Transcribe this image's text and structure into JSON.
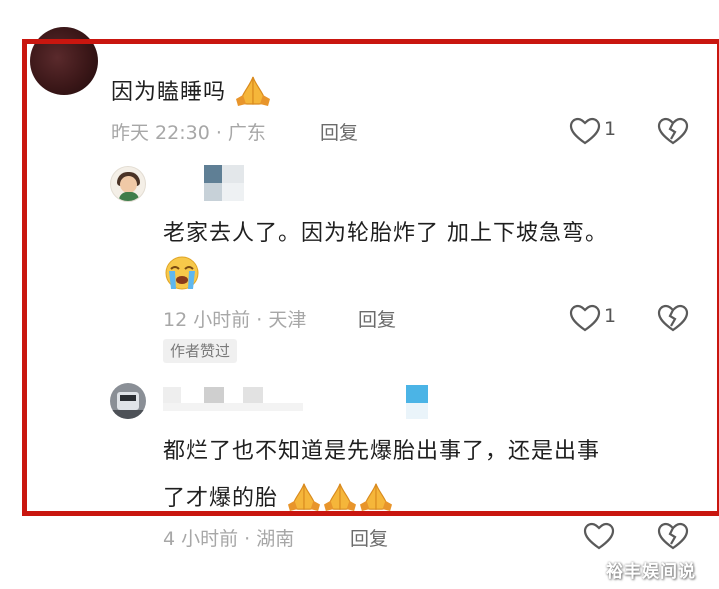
{
  "comments": [
    {
      "text": "因为瞌睡吗",
      "emoji": [
        "folded-hands"
      ],
      "time_location": "昨天 22:30 · 广东",
      "reply_label": "回复",
      "like_count": "1"
    },
    {
      "text": "老家去人了。因为轮胎炸了 加上下坡急弯。",
      "emoji": [
        "crying-face"
      ],
      "time_location": "12 小时前 · 天津",
      "reply_label": "回复",
      "like_count": "1",
      "badge": "作者赞过"
    },
    {
      "text_line1": "都烂了也不知道是先爆胎出事了，还是出事",
      "text_line2": "了才爆的胎",
      "emoji": [
        "folded-hands",
        "folded-hands",
        "folded-hands"
      ],
      "time_location": "4 小时前 · 湖南",
      "reply_label": "回复",
      "like_count": ""
    }
  ],
  "watermark": "裕丰娱间说",
  "colors": {
    "highlight_border": "#c9160f",
    "meta_text": "#a7a7a7",
    "body_text": "#1f1f1f"
  }
}
